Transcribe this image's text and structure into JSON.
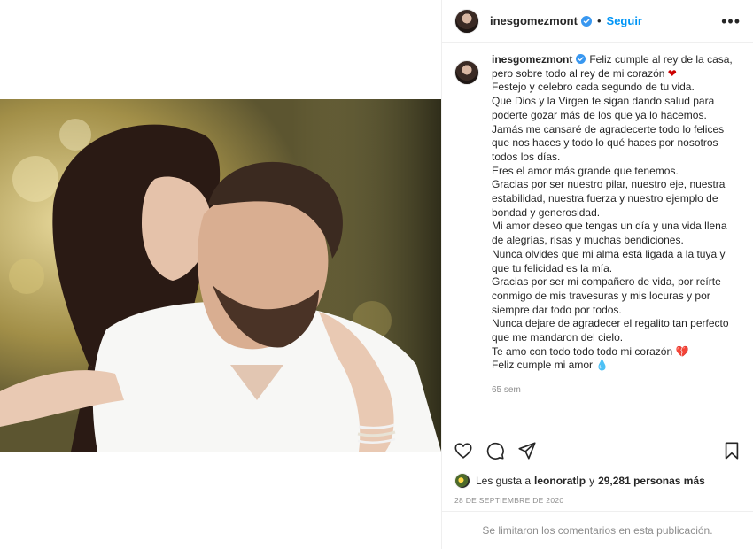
{
  "post": {
    "username": "inesgomezmont",
    "separator": "•",
    "follow_label": "Seguir",
    "more_label": "•••"
  },
  "caption": {
    "first_line": "Feliz cumple al rey de la casa, pero sobre todo al rey de mi corazón",
    "lines": [
      "Festejo y celebro cada segundo de tu vida.",
      "Que Dios y la Virgen te sigan dando salud para poderte gozar más de los que ya lo hacemos.",
      "Jamás me cansaré de agradecerte todo lo felices que nos haces y todo lo qué haces por nosotros todos los días.",
      "Eres el amor más grande que tenemos.",
      "Gracias por ser nuestro pilar, nuestro eje, nuestra estabilidad, nuestra fuerza y nuestro ejemplo de bondad y generosidad.",
      "Mi amor deseo que tengas un día y una vida llena de alegrías, risas y muchas bendiciones.",
      "Nunca olvides que mi alma está ligada a la tuya y que tu felicidad es la mía.",
      "Gracias por ser mi compañero de vida, por reírte conmigo de mis travesuras y mis locuras y por siempre dar todo por todos.",
      "Nunca dejare de agradecer el regalito tan perfecto que me mandaron del cielo."
    ],
    "love_line": "Te amo con todo todo todo mi corazón",
    "last_line": "Feliz cumple mi amor",
    "heart_red": "❤",
    "heart_broken": "💔",
    "heart_blue": "💧",
    "time_ago": "65 sem"
  },
  "likes": {
    "prefix": "Les gusta a",
    "user": "leonoratlp",
    "connector": "y",
    "count_text": "29,281 personas más"
  },
  "date_text": "28 de septiembre de 2020",
  "comments_disabled": "Se limitaron los comentarios en esta publicación.",
  "icons": {
    "like": "heart-outline-icon",
    "comment": "comment-bubble-icon",
    "share": "paper-plane-icon",
    "save": "bookmark-icon",
    "verified": "verified-badge-icon"
  },
  "colors": {
    "accent": "#0095f6",
    "muted": "#8e8e8e",
    "text": "#262626",
    "border": "#efefef",
    "verified": "#3897f0"
  }
}
